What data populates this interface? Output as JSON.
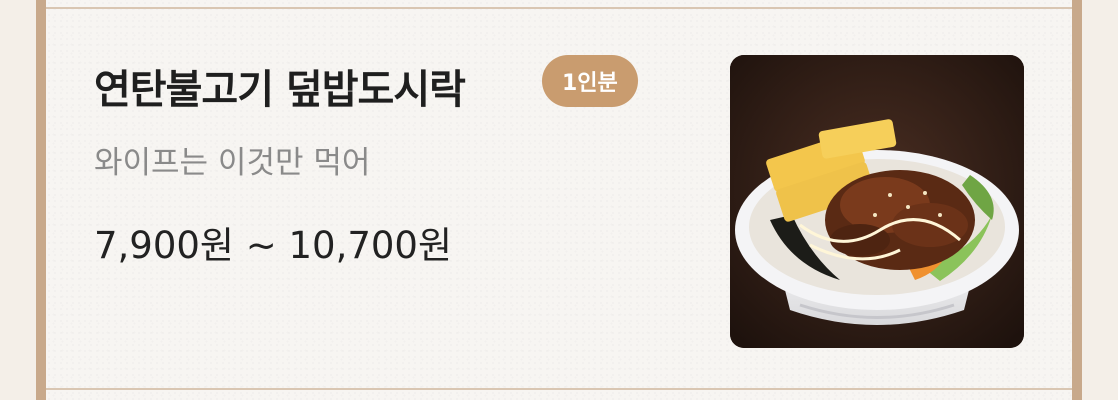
{
  "menu_item": {
    "name": "연탄불고기 덮밥도시락",
    "badge": "1인분",
    "description": "와이프는 이것만 먹어",
    "price_range": "7,900원 ~ 10,700원",
    "photo_icon": "bulgogi-rice-bowl-image"
  },
  "colors": {
    "badge_bg": "#c99c6f",
    "frame": "#c8a98b",
    "title": "#1f1f1f",
    "subtitle": "#8a8a8a"
  }
}
